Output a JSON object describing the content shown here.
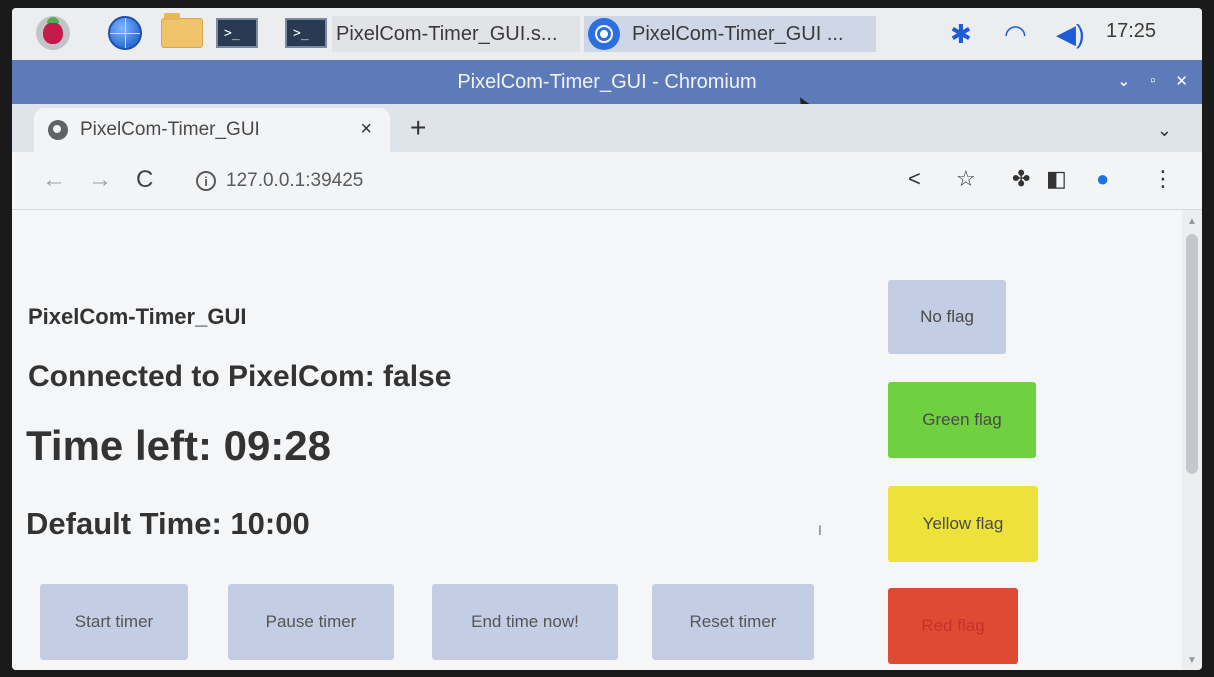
{
  "taskbar": {
    "tasks": [
      {
        "label": "PixelCom-Timer_GUI.s..."
      },
      {
        "label": "PixelCom-Timer_GUI ..."
      }
    ],
    "clock": "17:25"
  },
  "window": {
    "title": "PixelCom-Timer_GUI - Chromium"
  },
  "browser": {
    "tab_title": "PixelCom-Timer_GUI",
    "tab_close": "×",
    "new_tab": "+",
    "url": "127.0.0.1:39425"
  },
  "page": {
    "app_title": "PixelCom-Timer_GUI",
    "connected": "Connected to PixelCom: false",
    "time_left": "Time left: 09:28",
    "default_time": "Default Time: 10:00",
    "stray_mark": "I",
    "controls": {
      "start": "Start timer",
      "pause": "Pause timer",
      "end": "End time now!",
      "reset": "Reset timer"
    },
    "flags": {
      "none": "No flag",
      "green": "Green flag",
      "yellow": "Yellow flag",
      "red": "Red flag"
    }
  },
  "colors": {
    "titlebar": "#5c7bb8",
    "button_default": "#c3cde3",
    "flag_green": "#6fd13f",
    "flag_yellow": "#ede23a",
    "flag_red": "#e04a34"
  }
}
